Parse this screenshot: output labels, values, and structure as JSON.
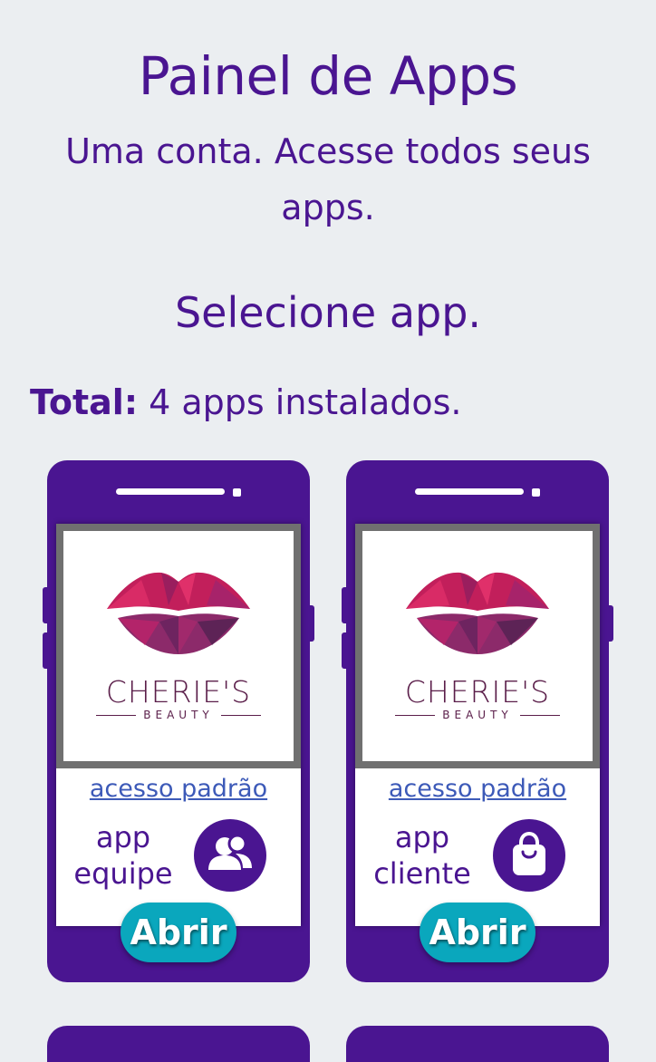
{
  "header": {
    "title": "Painel de Apps",
    "subtitle_line1": "Uma conta. Acesse todos seus",
    "subtitle_line2": "apps.",
    "select_prompt": "Selecione app."
  },
  "summary": {
    "total_label": "Total:",
    "total_text": "4 apps instalados."
  },
  "apps": [
    {
      "brand_name": "CHERIE'S",
      "brand_tagline": "BEAUTY",
      "access_link": "acesso padrão",
      "label_line1": "app",
      "label_line2": "equipe",
      "icon": "users-icon",
      "open_label": "Abrir"
    },
    {
      "brand_name": "CHERIE'S",
      "brand_tagline": "BEAUTY",
      "access_link": "acesso padrão",
      "label_line1": "app",
      "label_line2": "cliente",
      "icon": "shopping-bag-icon",
      "open_label": "Abrir"
    }
  ],
  "colors": {
    "primary": "#4a1591",
    "background": "#ebeef1",
    "button": "#0aa7bd",
    "link": "#3d5ab8",
    "brand_text": "#5a1d49"
  }
}
